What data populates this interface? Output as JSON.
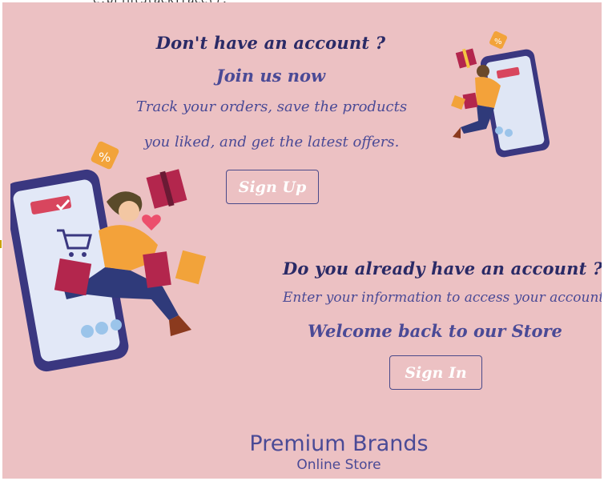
{
  "signup": {
    "heading": "Don't have an account ?",
    "subheading": "Join us now",
    "body_line1": "Track your orders, save the products",
    "body_line2": "you liked, and get the latest offers.",
    "button": "Sign Up"
  },
  "signin": {
    "heading": "Do you already have an account ?",
    "body": "Enter your information to access your account",
    "welcome": "Welcome back to our Store",
    "button": "Sign In"
  },
  "brand": {
    "name": "Premium Brands",
    "tagline": "Online Store"
  },
  "colors": {
    "background": "#ecc1c3",
    "heading": "#2a2a66",
    "accent": "#4a4a96",
    "button_text": "#ffffff"
  },
  "icons": {
    "top_illustration": "shopping-phone-illustration",
    "left_illustration": "shopping-phone-illustration"
  }
}
